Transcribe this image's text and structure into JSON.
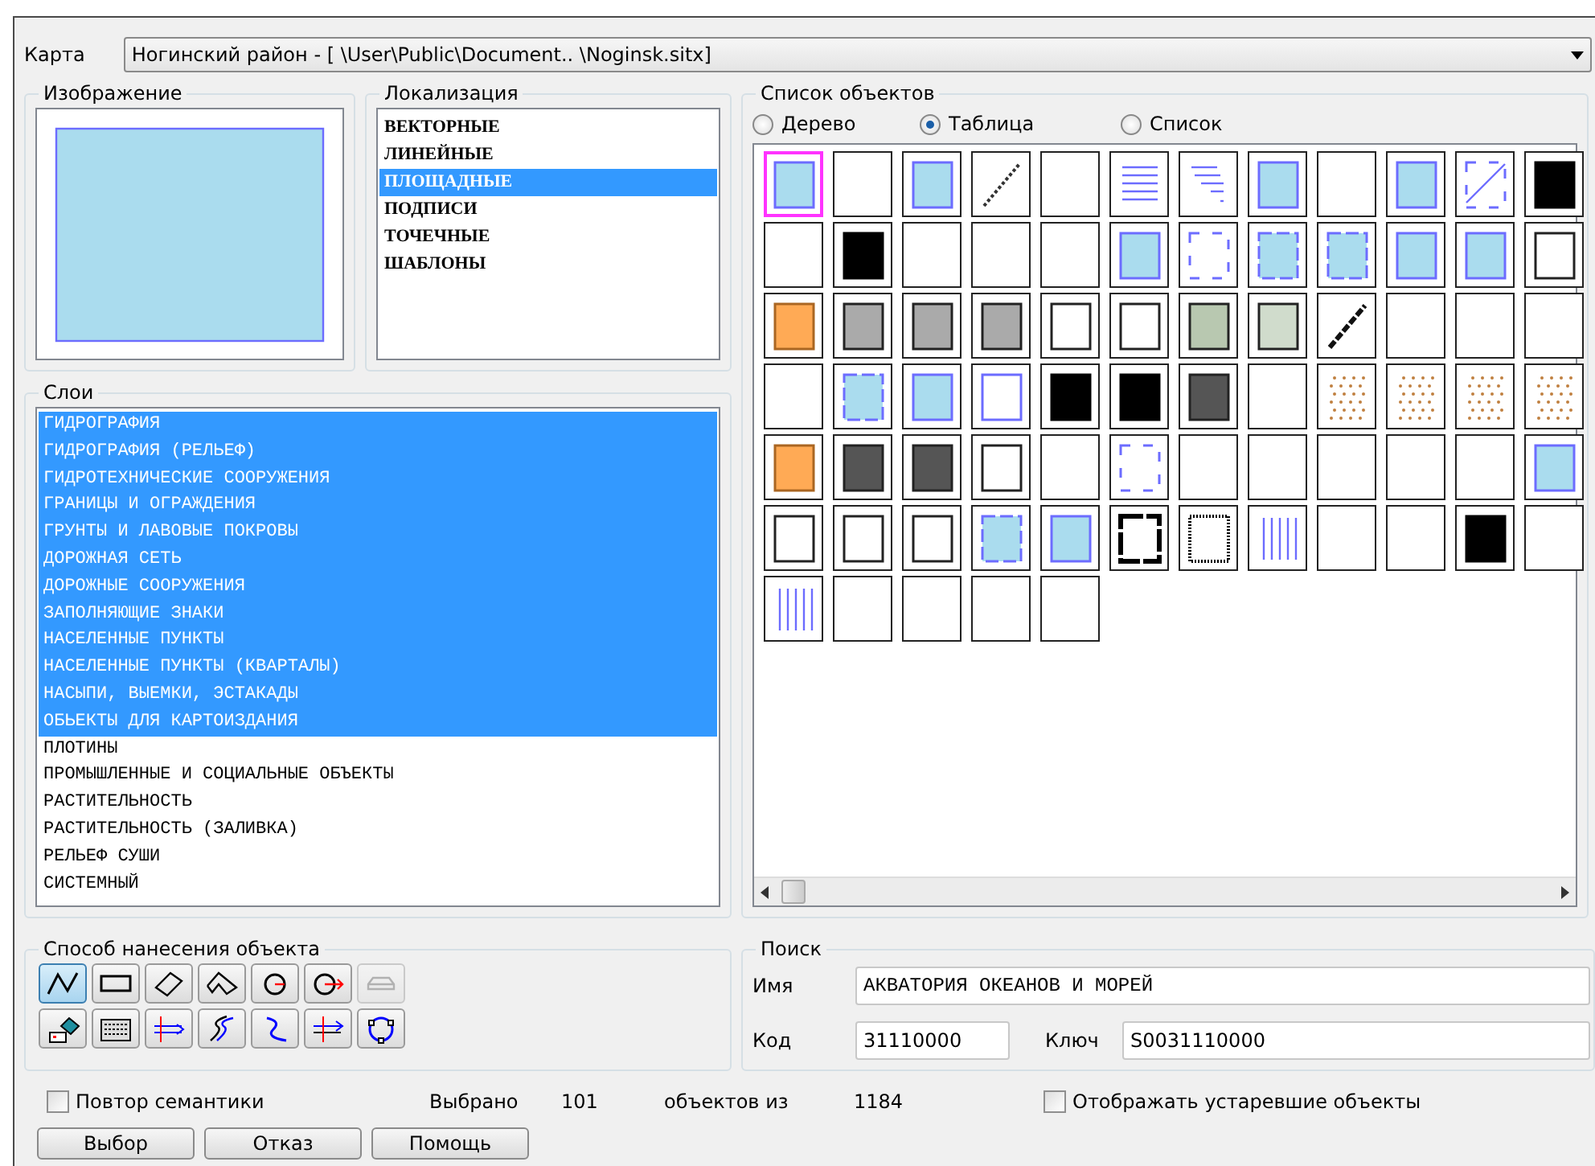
{
  "map": {
    "label": "Карта",
    "value": "Ногинский район - [ \\User\\Public\\Document.. \\Noginsk.sitx]"
  },
  "image_group": {
    "title": "Изображение"
  },
  "localization": {
    "title": "Локализация",
    "items": [
      {
        "label": "ВЕКТОРНЫЕ",
        "selected": false
      },
      {
        "label": "ЛИНЕЙНЫЕ",
        "selected": false
      },
      {
        "label": "ПЛОЩАДНЫЕ",
        "selected": true
      },
      {
        "label": "ПОДПИСИ",
        "selected": false
      },
      {
        "label": "ТОЧЕЧНЫЕ",
        "selected": false
      },
      {
        "label": "ШАБЛОНЫ",
        "selected": false
      }
    ]
  },
  "layers": {
    "title": "Слои",
    "items": [
      {
        "label": "ГИДРОГРАФИЯ",
        "selected": true
      },
      {
        "label": "ГИДРОГРАФИЯ (РЕЛЬЕФ)",
        "selected": true
      },
      {
        "label": "ГИДРОТЕХНИЧЕСКИЕ СООРУЖЕНИЯ",
        "selected": true
      },
      {
        "label": "ГРАНИЦЫ И ОГРАЖДЕНИЯ",
        "selected": true
      },
      {
        "label": "ГРУНТЫ И ЛАВОВЫЕ ПОКРОВЫ",
        "selected": true
      },
      {
        "label": "ДОРОЖНАЯ СЕТЬ",
        "selected": true
      },
      {
        "label": "ДОРОЖНЫЕ СООРУЖЕНИЯ",
        "selected": true
      },
      {
        "label": "ЗАПОЛНЯЮЩИЕ ЗНАКИ",
        "selected": true
      },
      {
        "label": "НАСЕЛЕННЫЕ ПУНКТЫ",
        "selected": true
      },
      {
        "label": "НАСЕЛЕННЫЕ ПУНКТЫ (КВАРТАЛЫ)",
        "selected": true
      },
      {
        "label": "НАСЫПИ, ВЫЕМКИ, ЭСТАКАДЫ",
        "selected": true
      },
      {
        "label": "ОБЬЕКТЫ ДЛЯ КАРТОИЗДАНИЯ",
        "selected": true
      },
      {
        "label": "ПЛОТИНЫ",
        "selected": false
      },
      {
        "label": "ПРОМЫШЛЕННЫЕ И СОЦИАЛЬНЫЕ ОБЪЕКТЫ",
        "selected": false
      },
      {
        "label": "РАСТИТЕЛЬНОСТЬ",
        "selected": false
      },
      {
        "label": "РАСТИТЕЛЬНОСТЬ (ЗАЛИВКА)",
        "selected": false
      },
      {
        "label": "РЕЛЬЕФ СУШИ",
        "selected": false
      },
      {
        "label": "СИСТЕМНЫЙ",
        "selected": false
      }
    ]
  },
  "objects": {
    "title": "Список объектов",
    "views": [
      {
        "label": "Дерево",
        "selected": false
      },
      {
        "label": "Таблица",
        "selected": true
      },
      {
        "label": "Список",
        "selected": false
      }
    ],
    "symbols": [
      {
        "kind": "blue",
        "selected": true
      },
      {
        "kind": "blank",
        "selected": false
      },
      {
        "kind": "blue",
        "selected": false
      },
      {
        "kind": "line",
        "selected": false
      },
      {
        "kind": "blank",
        "selected": false
      },
      {
        "kind": "hlines",
        "selected": false
      },
      {
        "kind": "steps",
        "selected": false
      },
      {
        "kind": "blue",
        "selected": false
      },
      {
        "kind": "blank",
        "selected": false
      },
      {
        "kind": "blue",
        "selected": false
      },
      {
        "kind": "diag",
        "selected": false
      },
      {
        "kind": "black",
        "selected": false
      },
      {
        "kind": "blank",
        "selected": false
      },
      {
        "kind": "black",
        "selected": false
      },
      {
        "kind": "blank",
        "selected": false
      },
      {
        "kind": "blank",
        "selected": false
      },
      {
        "kind": "blank",
        "selected": false
      },
      {
        "kind": "blue",
        "selected": false
      },
      {
        "kind": "corners",
        "selected": false
      },
      {
        "kind": "bluedash",
        "selected": false
      },
      {
        "kind": "bluedash",
        "selected": false
      },
      {
        "kind": "blue",
        "selected": false
      },
      {
        "kind": "blue",
        "selected": false
      },
      {
        "kind": "framed",
        "selected": false
      },
      {
        "kind": "orange",
        "selected": false
      },
      {
        "kind": "gray",
        "selected": false
      },
      {
        "kind": "gray",
        "selected": false
      },
      {
        "kind": "gray",
        "selected": false
      },
      {
        "kind": "framed",
        "selected": false
      },
      {
        "kind": "framed",
        "selected": false
      },
      {
        "kind": "green",
        "selected": false
      },
      {
        "kind": "palegreen",
        "selected": false
      },
      {
        "kind": "heavyline",
        "selected": false
      },
      {
        "kind": "blank",
        "selected": false
      },
      {
        "kind": "blank",
        "selected": false
      },
      {
        "kind": "blank",
        "selected": false
      },
      {
        "kind": "blank",
        "selected": false
      },
      {
        "kind": "bluedash",
        "selected": false
      },
      {
        "kind": "blue",
        "selected": false
      },
      {
        "kind": "outline",
        "selected": false
      },
      {
        "kind": "black",
        "selected": false
      },
      {
        "kind": "black",
        "selected": false
      },
      {
        "kind": "darkgray",
        "selected": false
      },
      {
        "kind": "blank",
        "selected": false
      },
      {
        "kind": "dots",
        "selected": false
      },
      {
        "kind": "dots",
        "selected": false
      },
      {
        "kind": "dots",
        "selected": false
      },
      {
        "kind": "dots",
        "selected": false
      },
      {
        "kind": "orange",
        "selected": false
      },
      {
        "kind": "darkgray",
        "selected": false
      },
      {
        "kind": "darkgray",
        "selected": false
      },
      {
        "kind": "framed",
        "selected": false
      },
      {
        "kind": "blank",
        "selected": false
      },
      {
        "kind": "corners",
        "selected": false
      },
      {
        "kind": "blank",
        "selected": false
      },
      {
        "kind": "blank",
        "selected": false
      },
      {
        "kind": "blank",
        "selected": false
      },
      {
        "kind": "blank",
        "selected": false
      },
      {
        "kind": "blank",
        "selected": false
      },
      {
        "kind": "blue",
        "selected": false
      },
      {
        "kind": "framed",
        "selected": false
      },
      {
        "kind": "framed",
        "selected": false
      },
      {
        "kind": "framed",
        "selected": false
      },
      {
        "kind": "bluedash",
        "selected": false
      },
      {
        "kind": "blue",
        "selected": false
      },
      {
        "kind": "thickframe",
        "selected": false
      },
      {
        "kind": "dottedframe",
        "selected": false
      },
      {
        "kind": "vlines",
        "selected": false
      },
      {
        "kind": "blank",
        "selected": false
      },
      {
        "kind": "blank",
        "selected": false
      },
      {
        "kind": "black",
        "selected": false
      },
      {
        "kind": "blank",
        "selected": false
      },
      {
        "kind": "vlines",
        "selected": false
      },
      {
        "kind": "blank",
        "selected": false
      },
      {
        "kind": "blank",
        "selected": false
      },
      {
        "kind": "blank",
        "selected": false
      },
      {
        "kind": "blank",
        "selected": false
      }
    ]
  },
  "drawing_method": {
    "title": "Способ нанесения объекта",
    "tools": [
      {
        "kind": "polyline",
        "selected": true,
        "disabled": false
      },
      {
        "kind": "rectangle",
        "selected": false,
        "disabled": false
      },
      {
        "kind": "tilted",
        "selected": false,
        "disabled": false
      },
      {
        "kind": "angle",
        "selected": false,
        "disabled": false
      },
      {
        "kind": "circle",
        "selected": false,
        "disabled": false
      },
      {
        "kind": "circlearrow",
        "selected": false,
        "disabled": false
      },
      {
        "kind": "car",
        "selected": false,
        "disabled": true
      },
      {
        "kind": "bucket",
        "selected": false,
        "disabled": false
      },
      {
        "kind": "keyboard",
        "selected": false,
        "disabled": false
      },
      {
        "kind": "parallel",
        "selected": false,
        "disabled": false
      },
      {
        "kind": "wave",
        "selected": false,
        "disabled": false
      },
      {
        "kind": "curve",
        "selected": false,
        "disabled": false
      },
      {
        "kind": "cross",
        "selected": false,
        "disabled": false
      },
      {
        "kind": "ring",
        "selected": false,
        "disabled": false
      }
    ]
  },
  "search": {
    "title": "Поиск",
    "name_label": "Имя",
    "name_value": "АКВАТОРИЯ ОКЕАНОВ И МОРЕЙ",
    "code_label": "Код",
    "code_value": "31110000",
    "key_label": "Ключ",
    "key_value": "S0031110000"
  },
  "status": {
    "repeat_semantics": {
      "label": "Повтор семантики",
      "checked": false
    },
    "selected_label": "Выбрано",
    "selected_count": "101",
    "of_label": "объектов из",
    "total_count": "1184",
    "show_obsolete": {
      "label": "Отображать устаревшие объекты",
      "checked": false
    }
  },
  "buttons": [
    "Выбор",
    "Отказ",
    "Помощь"
  ]
}
